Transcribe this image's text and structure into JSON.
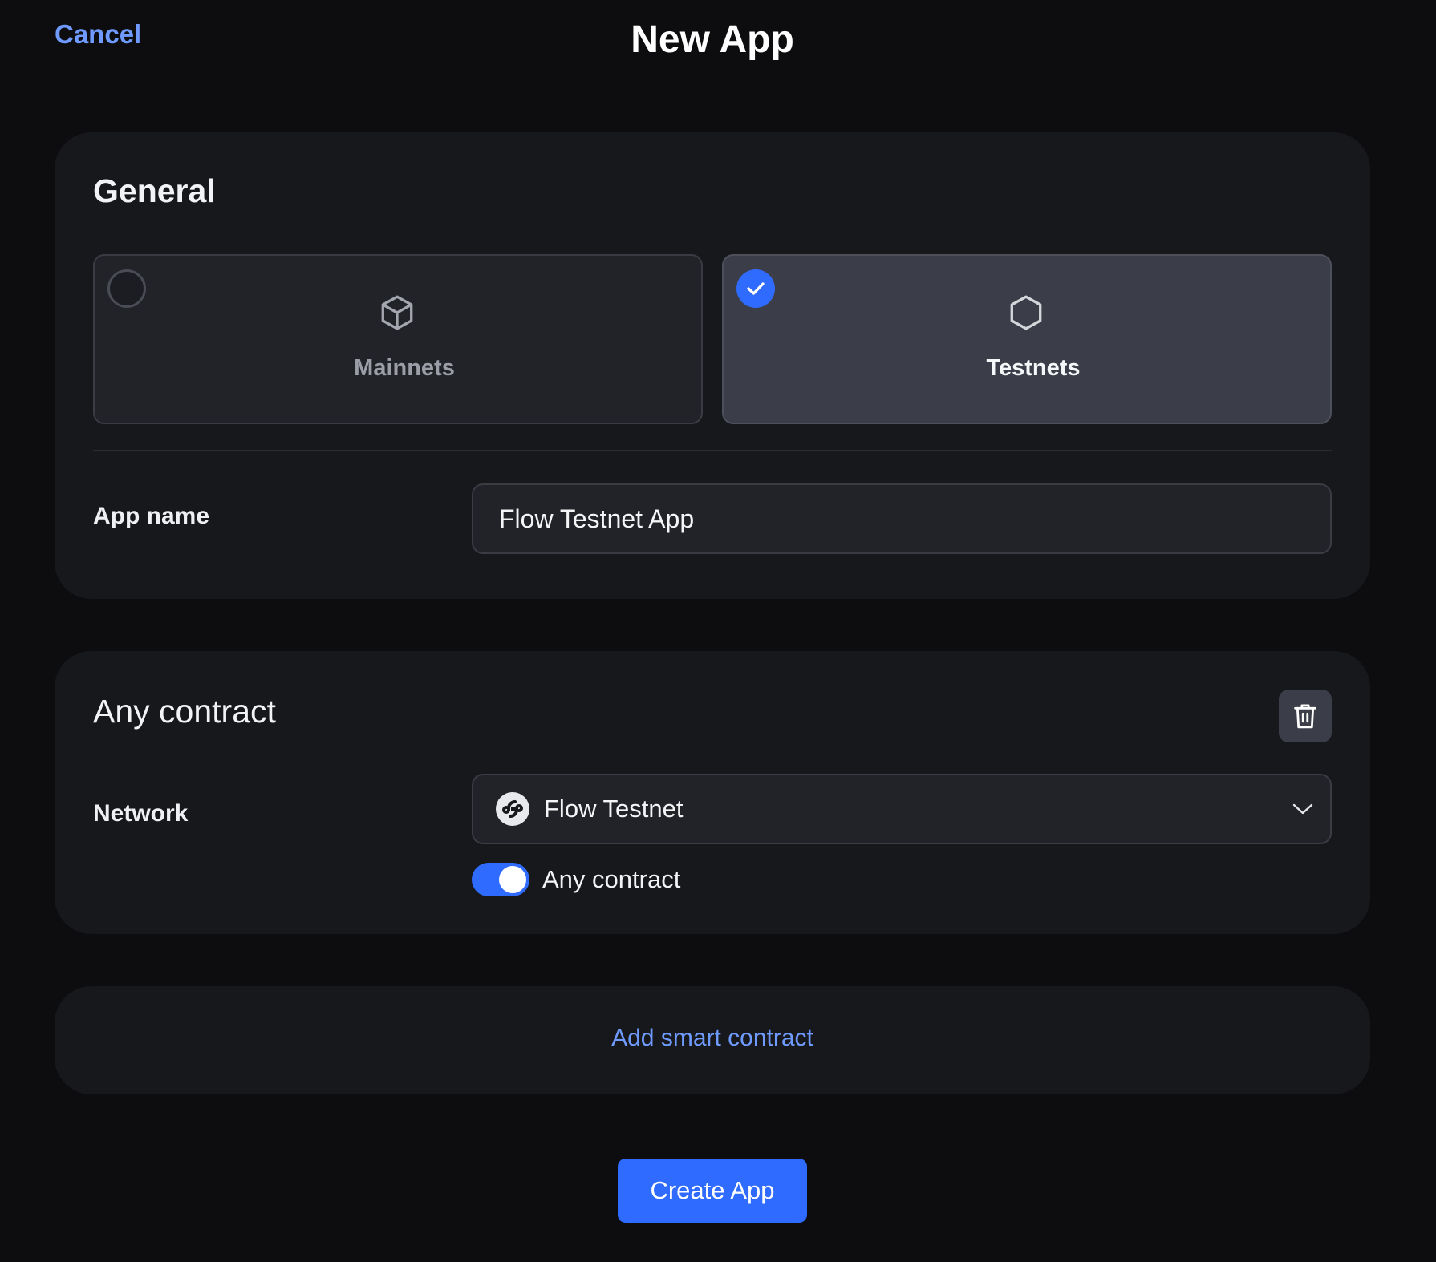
{
  "header": {
    "cancel_label": "Cancel",
    "title": "New App"
  },
  "general": {
    "title": "General",
    "options": [
      {
        "label": "Mainnets",
        "selected": false,
        "icon": "cube-icon"
      },
      {
        "label": "Testnets",
        "selected": true,
        "icon": "hexagon-icon"
      }
    ],
    "app_name_label": "App name",
    "app_name_value": "Flow Testnet App"
  },
  "contract": {
    "title": "Any contract",
    "network_label": "Network",
    "network_value": "Flow Testnet",
    "network_icon": "flow-logo-icon",
    "toggle_label": "Any contract",
    "toggle_on": true
  },
  "add_contract": {
    "label": "Add smart contract"
  },
  "footer": {
    "create_label": "Create App"
  },
  "colors": {
    "background": "#0d0d0f",
    "card": "#17181c",
    "accent": "#2f6bff",
    "link": "#6f9bff"
  }
}
